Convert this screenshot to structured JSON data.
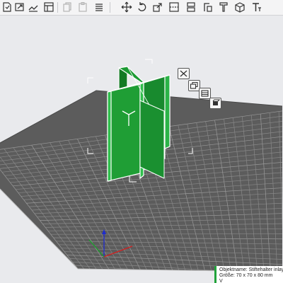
{
  "toolbar": {
    "icons": [
      "import-icon",
      "scale-to-plate-icon",
      "model-settings-icon",
      "copy-icon",
      "paste-icon",
      "separator-icon",
      "move-icon",
      "rotate-icon",
      "scale-icon",
      "mirror-icon",
      "place-on-face-icon",
      "cube-icon",
      "text-icon"
    ]
  },
  "side_panel": {
    "icons": [
      "remove-icon",
      "duplicate-icon",
      "layers-icon",
      "settings-icon"
    ]
  },
  "info_panel": {
    "object_name": "Objektname: Stiftehalter inlay",
    "size": "Größe: 70 x 70 x 80 mm",
    "volume": "V"
  },
  "colors": {
    "model": "#1f9e35",
    "model_dark": "#137a24",
    "plate": "#5c5c5c",
    "grid": "#8a8a8a",
    "background": "#e9eaed",
    "accent": "#21a33a"
  }
}
